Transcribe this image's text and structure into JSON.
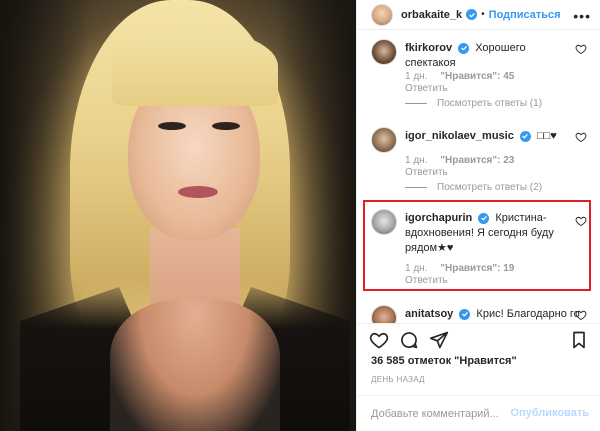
{
  "header": {
    "username": "orbakaite_k",
    "separator": "•",
    "follow_label": "Подписаться",
    "more_icon": "more-horizontal-icon"
  },
  "comments": [
    {
      "username": "fkirkorov",
      "text": "Хорошего спектакоя",
      "time": "1 дн.",
      "likes": "\"Нравится\": 45",
      "reply": "Ответить",
      "view_replies": "Посмотреть ответы (1)"
    },
    {
      "username": "igor_nikolaev_music",
      "text": "□□♥",
      "time": "1 дн.",
      "likes": "\"Нравится\": 23",
      "reply": "Ответить",
      "view_replies": "Посмотреть ответы (2)"
    },
    {
      "username": "igorchapurin",
      "text": "Кристина-вдохновения! Я сегодня буду рядом★♥",
      "time": "1 дн.",
      "likes": "\"Нравится\": 19",
      "reply": "Ответить"
    },
    {
      "username": "anitatsoy",
      "text": "Крис! Благодарно го"
    }
  ],
  "likes_summary": "36 585 отметок \"Нравится\"",
  "time_ago": "День назад",
  "add_comment": {
    "placeholder": "Добавьте комментарий...",
    "publish_label": "Опубликовать"
  },
  "colors": {
    "accent": "#3897f0",
    "highlight": "#e02020",
    "muted": "#999999"
  }
}
